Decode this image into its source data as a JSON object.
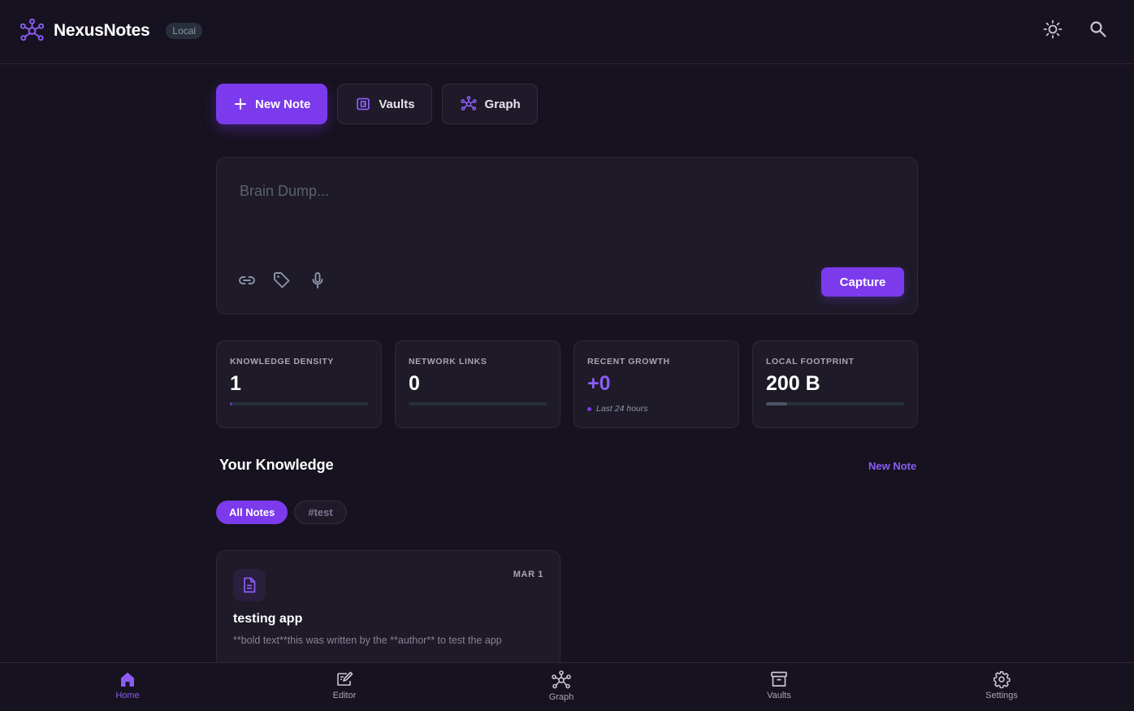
{
  "app": {
    "name": "NexusNotes",
    "badge": "Local"
  },
  "icons": {
    "logo": "network-graph-icon",
    "theme": "sun-icon",
    "search": "search-icon"
  },
  "colors": {
    "accent": "#7c3aed",
    "accent_text": "#8b5cf6",
    "background": "#17121f",
    "card": "#1e1a27"
  },
  "actions": {
    "new_note": "New Note",
    "vaults": "Vaults",
    "graph": "Graph"
  },
  "capture": {
    "placeholder": "Brain Dump...",
    "value": "",
    "button": "Capture",
    "tools": [
      "link-icon",
      "tag-icon",
      "microphone-icon"
    ]
  },
  "stats": [
    {
      "label": "KNOWLEDGE DENSITY",
      "value": "1",
      "progress": 0.01
    },
    {
      "label": "NETWORK LINKS",
      "value": "0",
      "progress": 0
    },
    {
      "label": "RECENT GROWTH",
      "value": "+0",
      "note": "Last 24 hours"
    },
    {
      "label": "LOCAL FOOTPRINT",
      "value": "200 B",
      "progress": 0.15
    }
  ],
  "knowledge": {
    "title": "Your Knowledge",
    "new_note_link": "New Note",
    "filters": [
      "All Notes",
      "#test"
    ],
    "active_filter": "All Notes",
    "notes": [
      {
        "date": "MAR 1",
        "title": "testing app",
        "excerpt": "**bold text**this was written by the **author** to test the app"
      }
    ]
  },
  "bottom_nav": {
    "items": [
      {
        "label": "Home",
        "icon": "home-icon",
        "active": true
      },
      {
        "label": "Editor",
        "icon": "editor-icon",
        "active": false
      },
      {
        "label": "Graph",
        "icon": "graph-icon",
        "active": false
      },
      {
        "label": "Vaults",
        "icon": "archive-icon",
        "active": false
      },
      {
        "label": "Settings",
        "icon": "gear-icon",
        "active": false
      }
    ]
  }
}
